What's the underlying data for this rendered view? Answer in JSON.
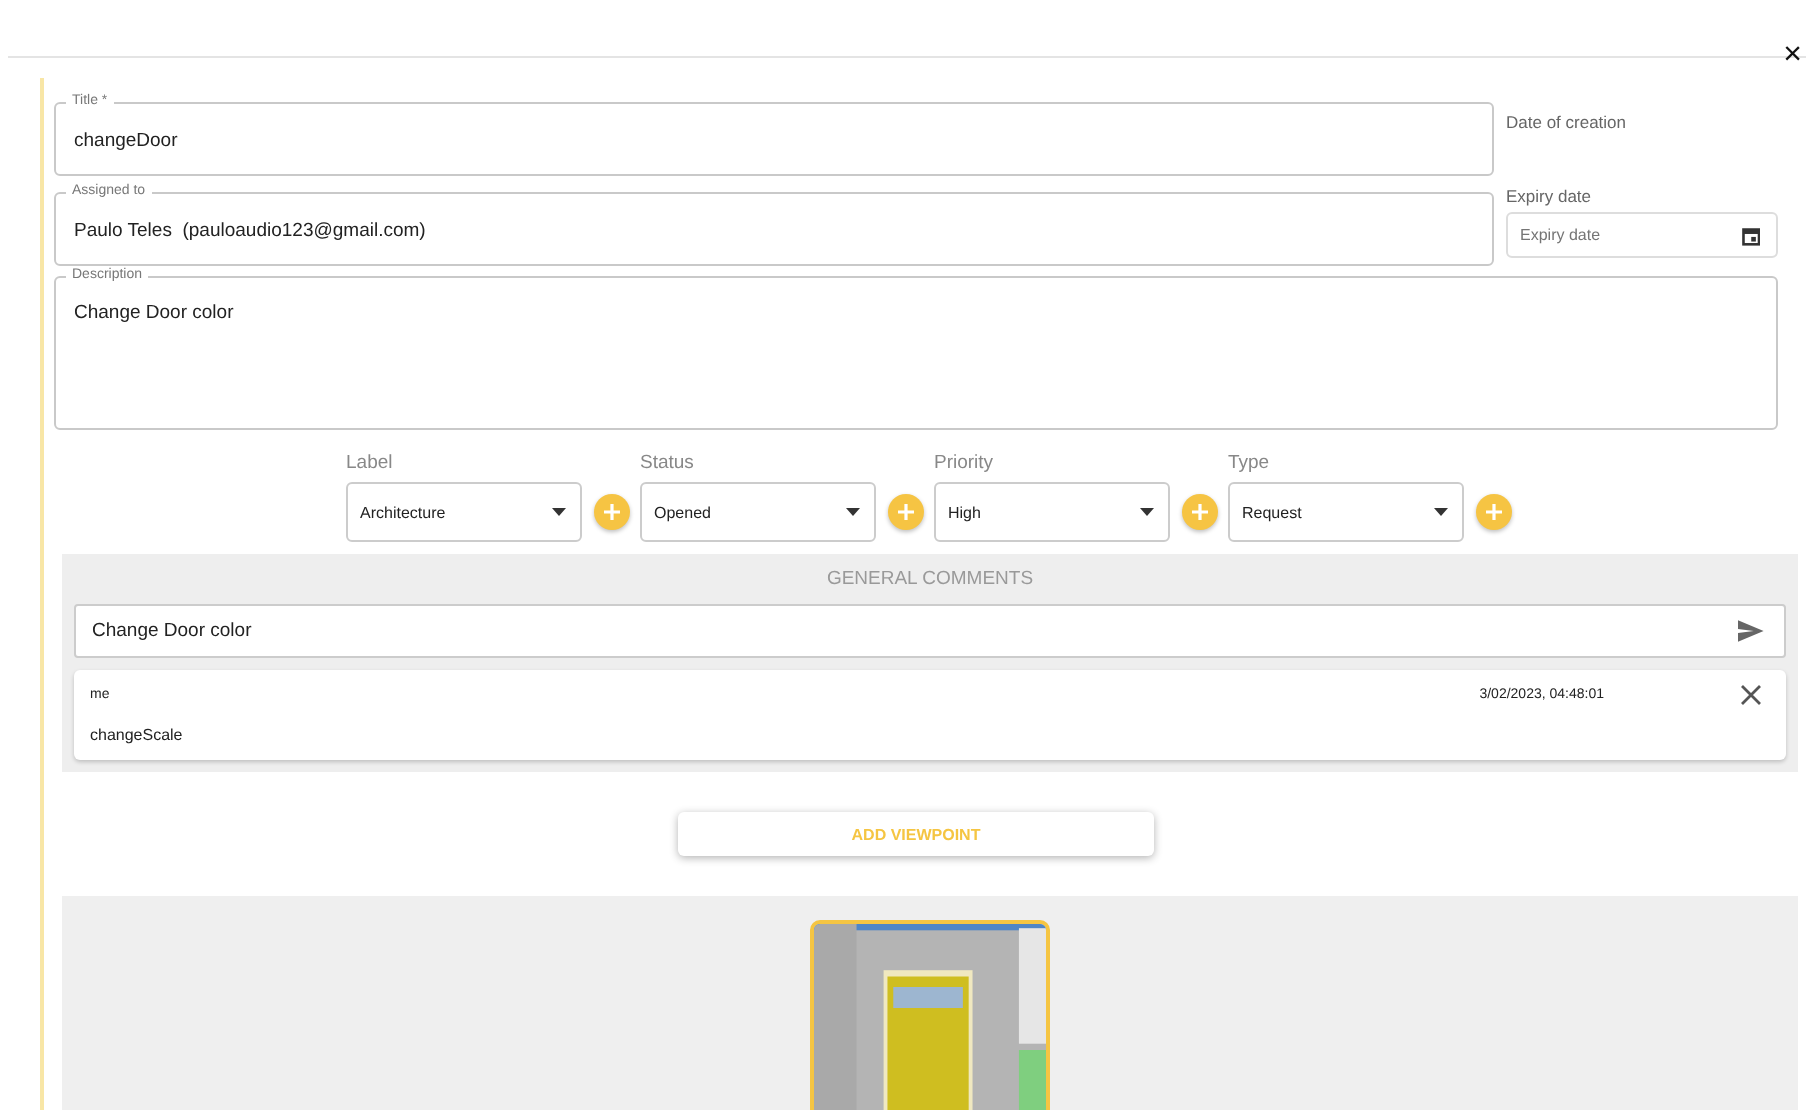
{
  "close_label": "×",
  "fields": {
    "title": {
      "label": "Title *",
      "value": "changeDoor"
    },
    "assigned_to": {
      "label": "Assigned to",
      "value": "Paulo Teles  (pauloaudio123@gmail.com)"
    },
    "description": {
      "label": "Description",
      "value": "Change Door color"
    }
  },
  "date_of_creation": {
    "label": "Date of creation"
  },
  "expiry_date": {
    "label": "Expiry date",
    "placeholder": "Expiry date"
  },
  "selectors": [
    {
      "label": "Label",
      "value": "Architecture"
    },
    {
      "label": "Status",
      "value": "Opened"
    },
    {
      "label": "Priority",
      "value": "High"
    },
    {
      "label": "Type",
      "value": "Request"
    }
  ],
  "comments": {
    "heading": "GENERAL COMMENTS",
    "input_value": "Change Door color",
    "items": [
      {
        "author": "me",
        "timestamp": "3/02/2023, 04:48:01",
        "text": "changeScale"
      }
    ]
  },
  "add_viewpoint_button": "ADD VIEWPOINT",
  "viewpoints": [
    {
      "kind": "picture",
      "selected": true
    }
  ]
}
